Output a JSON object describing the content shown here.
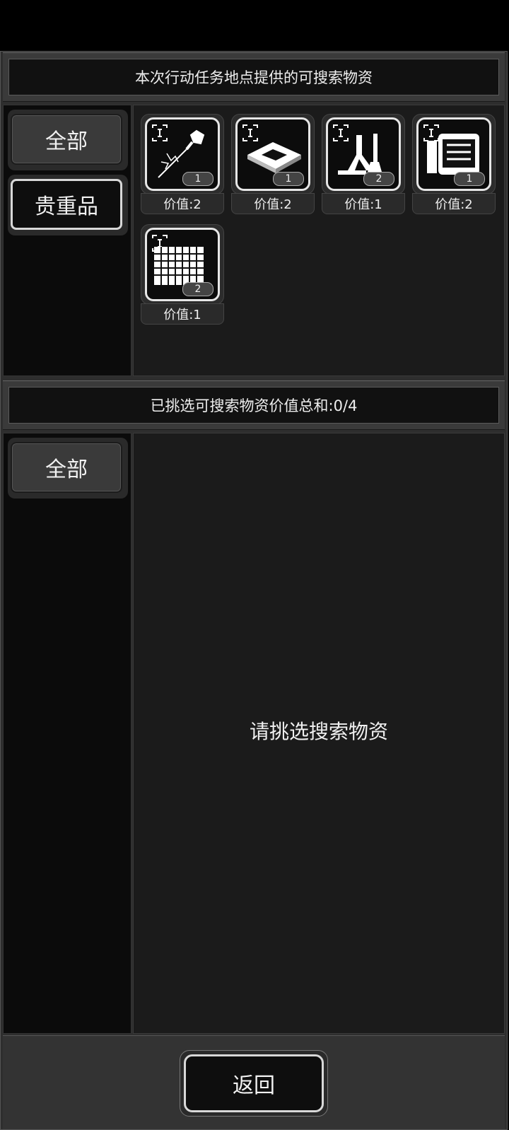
{
  "top_panel": {
    "banner": "本次行动任务地点提供的可搜索物资",
    "tabs": [
      {
        "label": "全部",
        "selected": true
      },
      {
        "label": "贵重品",
        "selected": false
      }
    ],
    "items": [
      {
        "icon": "syringe-icon",
        "qty": "1",
        "value": "价值:2"
      },
      {
        "icon": "microchip-icon",
        "qty": "1",
        "value": "价值:2"
      },
      {
        "icon": "lab-equipment-icon",
        "qty": "2",
        "value": "价值:1"
      },
      {
        "icon": "electronic-device-icon",
        "qty": "1",
        "value": "价值:2"
      },
      {
        "icon": "circuit-board-icon",
        "qty": "2",
        "value": "价值:1"
      }
    ]
  },
  "bottom_panel": {
    "banner": "已挑选可搜索物资价值总和:0/4",
    "tabs": [
      {
        "label": "全部",
        "selected": true
      }
    ],
    "empty_message": "请挑选搜索物资"
  },
  "footer": {
    "back_label": "返回"
  }
}
